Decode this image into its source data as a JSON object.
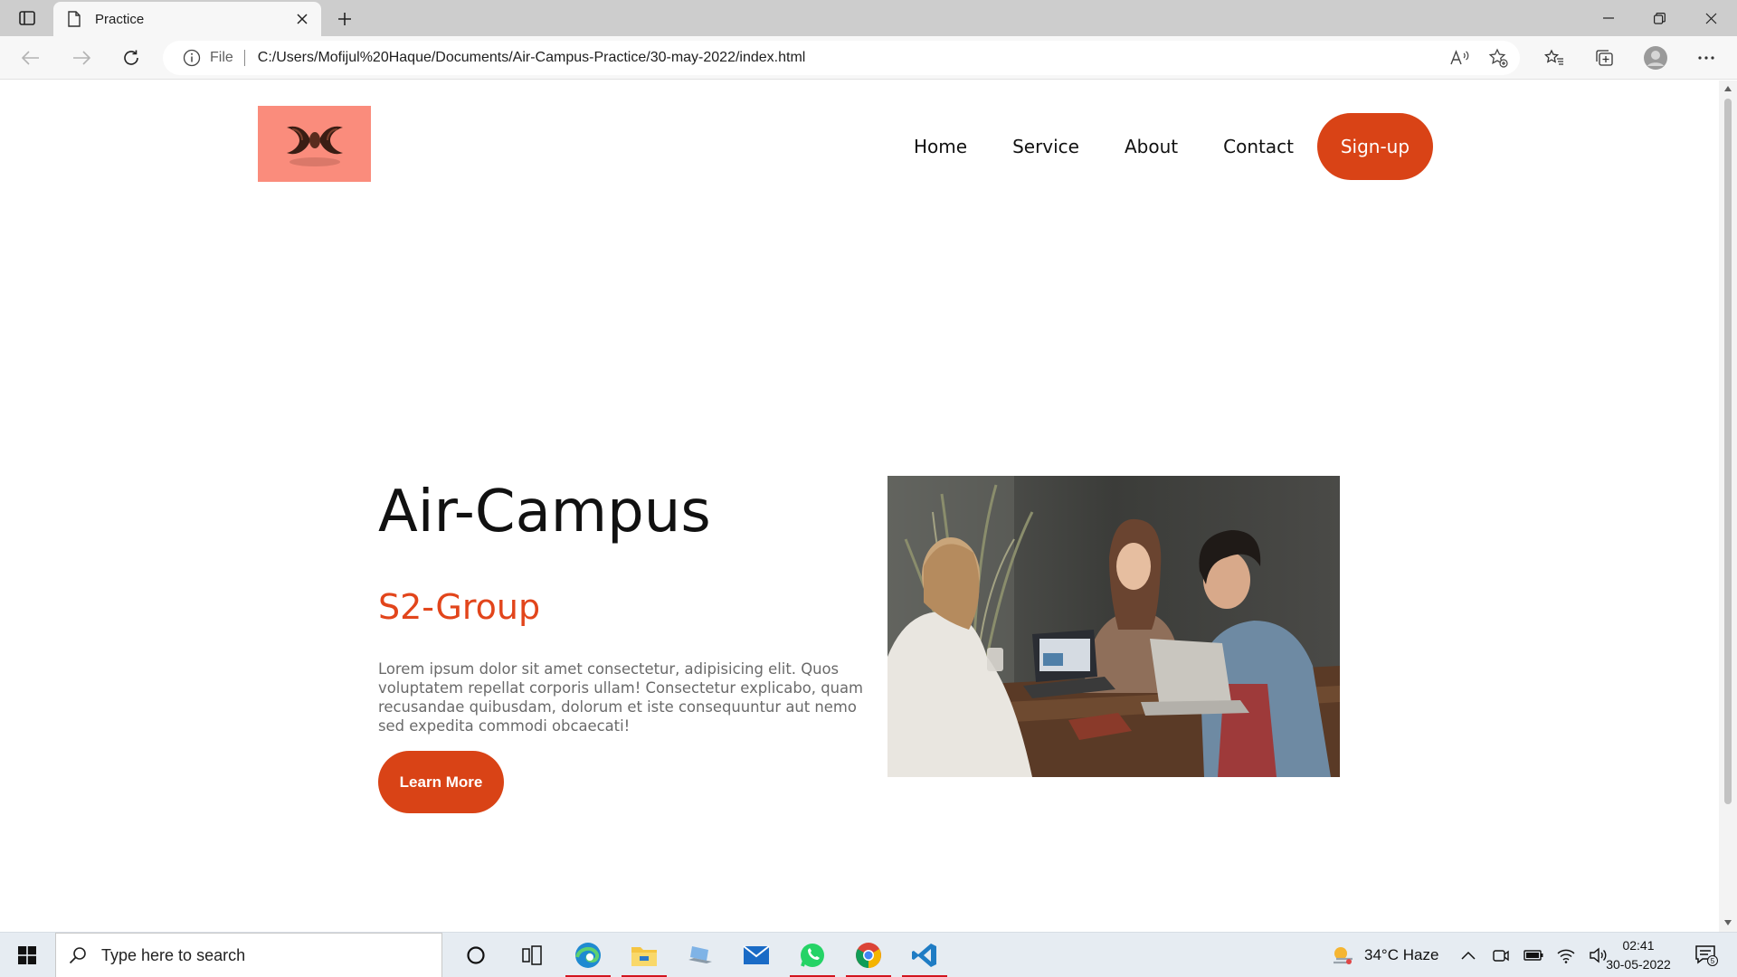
{
  "browser": {
    "tab_title": "Practice",
    "address_scheme": "File",
    "address_url": "C:/Users/Mofijul%20Haque/Documents/Air-Campus-Practice/30-may-2022/index.html"
  },
  "site": {
    "nav": {
      "items": [
        {
          "label": "Home"
        },
        {
          "label": "Service"
        },
        {
          "label": "About"
        },
        {
          "label": "Contact"
        }
      ],
      "signup_label": "Sign-up"
    },
    "hero": {
      "title": "Air-Campus",
      "subtitle": "S2-Group",
      "body": "Lorem ipsum dolor sit amet consectetur, adipisicing elit. Quos voluptatem repellat corporis ullam! Consectetur explicabo, quam recusandae quibusdam, dolorum et iste consequuntur aut nemo sed expedita commodi obcaecati!",
      "button_label": "Learn More"
    },
    "colors": {
      "accent": "#d94316",
      "subtitle": "#e2451b",
      "logo_bg": "#fa8c7c"
    }
  },
  "taskbar": {
    "search_placeholder": "Type here to search",
    "weather": "34°C  Haze",
    "time": "02:41",
    "date": "30-05-2022",
    "notification_count": "5"
  }
}
